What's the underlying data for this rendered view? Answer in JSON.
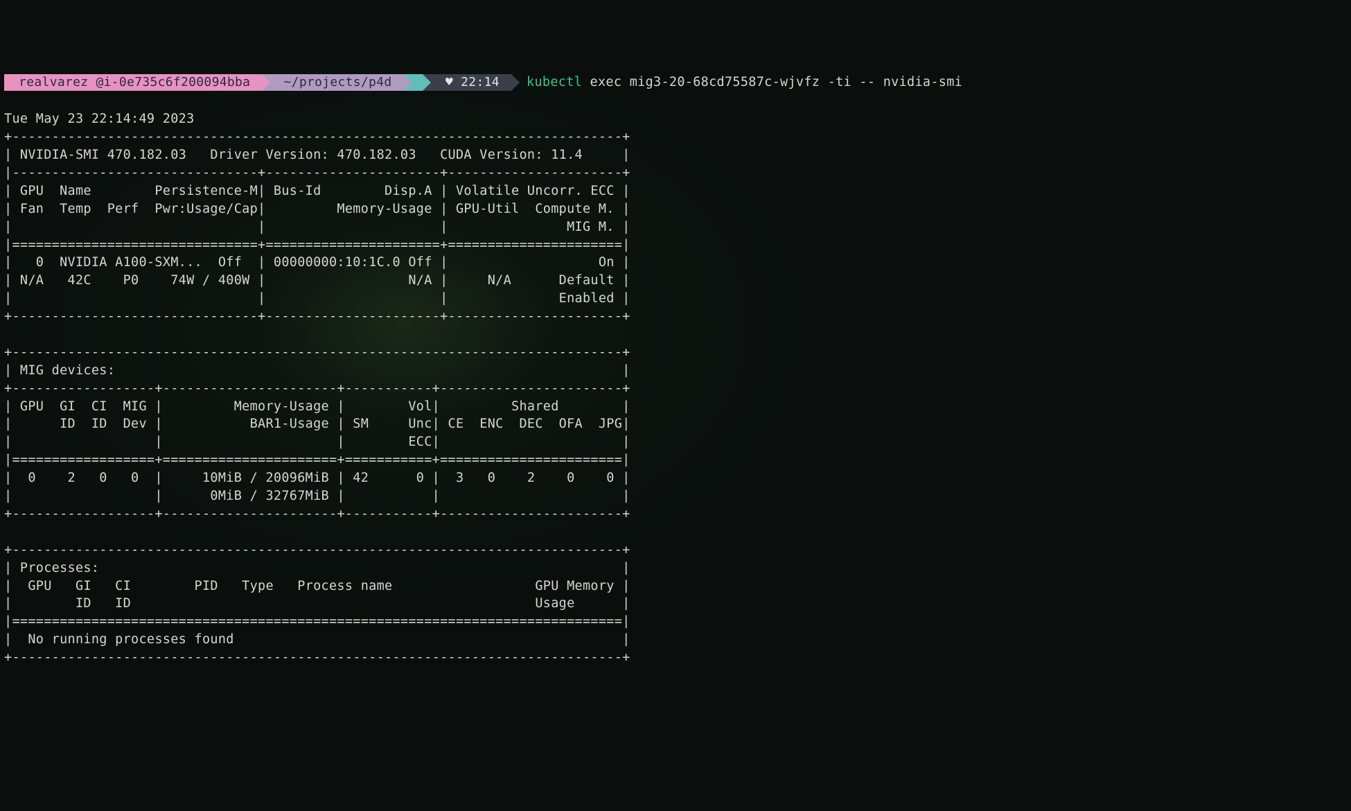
{
  "prompt": {
    "user": "realvarez",
    "host": "@i-0e735c6f200094bba",
    "path": "~/projects/p4d",
    "heart": "♥",
    "time": "22:14",
    "cmd_kw": "kubectl",
    "cmd_args": " exec mig3-20-68cd75587c-wjvfz -ti -- nvidia-smi"
  },
  "nvidia_smi": {
    "timestamp": "Tue May 23 22:14:49 2023",
    "smi_version": "470.182.03",
    "driver_version": "470.182.03",
    "cuda_version": "11.4",
    "gpu": {
      "index": "0",
      "name": "NVIDIA A100-SXM...",
      "persistence_m": "Off",
      "bus_id": "00000000:10:1C.0",
      "disp_a": "Off",
      "ecc": "On",
      "fan": "N/A",
      "temp": "42C",
      "perf": "P0",
      "pwr": "74W / 400W",
      "mem_usage": "N/A",
      "gpu_util": "N/A",
      "compute_m": "Default",
      "mig_m": "Enabled"
    },
    "mig": {
      "gpu": "0",
      "gi_id": "2",
      "ci_id": "0",
      "mig_dev": "0",
      "mem_usage": "10MiB / 20096MiB",
      "bar1_usage": "0MiB / 32767MiB",
      "sm": "42",
      "vol_unc_ecc": "0",
      "ce": "3",
      "enc": "0",
      "dec": "2",
      "ofa": "0",
      "jpg": "0"
    },
    "processes": {
      "msg": "No running processes found"
    }
  },
  "lines": {
    "l01": "+-----------------------------------------------------------------------------+",
    "l02": "| NVIDIA-SMI 470.182.03   Driver Version: 470.182.03   CUDA Version: 11.4     |",
    "l03": "|-------------------------------+----------------------+----------------------+",
    "l04": "| GPU  Name        Persistence-M| Bus-Id        Disp.A | Volatile Uncorr. ECC |",
    "l05": "| Fan  Temp  Perf  Pwr:Usage/Cap|         Memory-Usage | GPU-Util  Compute M. |",
    "l06": "|                               |                      |               MIG M. |",
    "l07": "|===============================+======================+======================|",
    "l08": "|   0  NVIDIA A100-SXM...  Off  | 00000000:10:1C.0 Off |                   On |",
    "l09": "| N/A   42C    P0    74W / 400W |                  N/A |     N/A      Default |",
    "l10": "|                               |                      |              Enabled |",
    "l11": "+-------------------------------+----------------------+----------------------+",
    "l12": "",
    "l13": "+-----------------------------------------------------------------------------+",
    "l14": "| MIG devices:                                                                |",
    "l15": "+------------------+----------------------+-----------+-----------------------+",
    "l16": "| GPU  GI  CI  MIG |         Memory-Usage |        Vol|         Shared        |",
    "l17": "|      ID  ID  Dev |           BAR1-Usage | SM     Unc| CE  ENC  DEC  OFA  JPG|",
    "l18": "|                  |                      |        ECC|                       |",
    "l19": "|==================+======================+===========+=======================|",
    "l20": "|  0    2   0   0  |     10MiB / 20096MiB | 42      0 |  3   0    2    0    0 |",
    "l21": "|                  |      0MiB / 32767MiB |           |                       |",
    "l22": "+------------------+----------------------+-----------+-----------------------+",
    "l23": "",
    "l24": "+-----------------------------------------------------------------------------+",
    "l25": "| Processes:                                                                  |",
    "l26": "|  GPU   GI   CI        PID   Type   Process name                  GPU Memory |",
    "l27": "|        ID   ID                                                   Usage      |",
    "l28": "|=============================================================================|",
    "l29": "|  No running processes found                                                 |",
    "l30": "+-----------------------------------------------------------------------------+"
  }
}
